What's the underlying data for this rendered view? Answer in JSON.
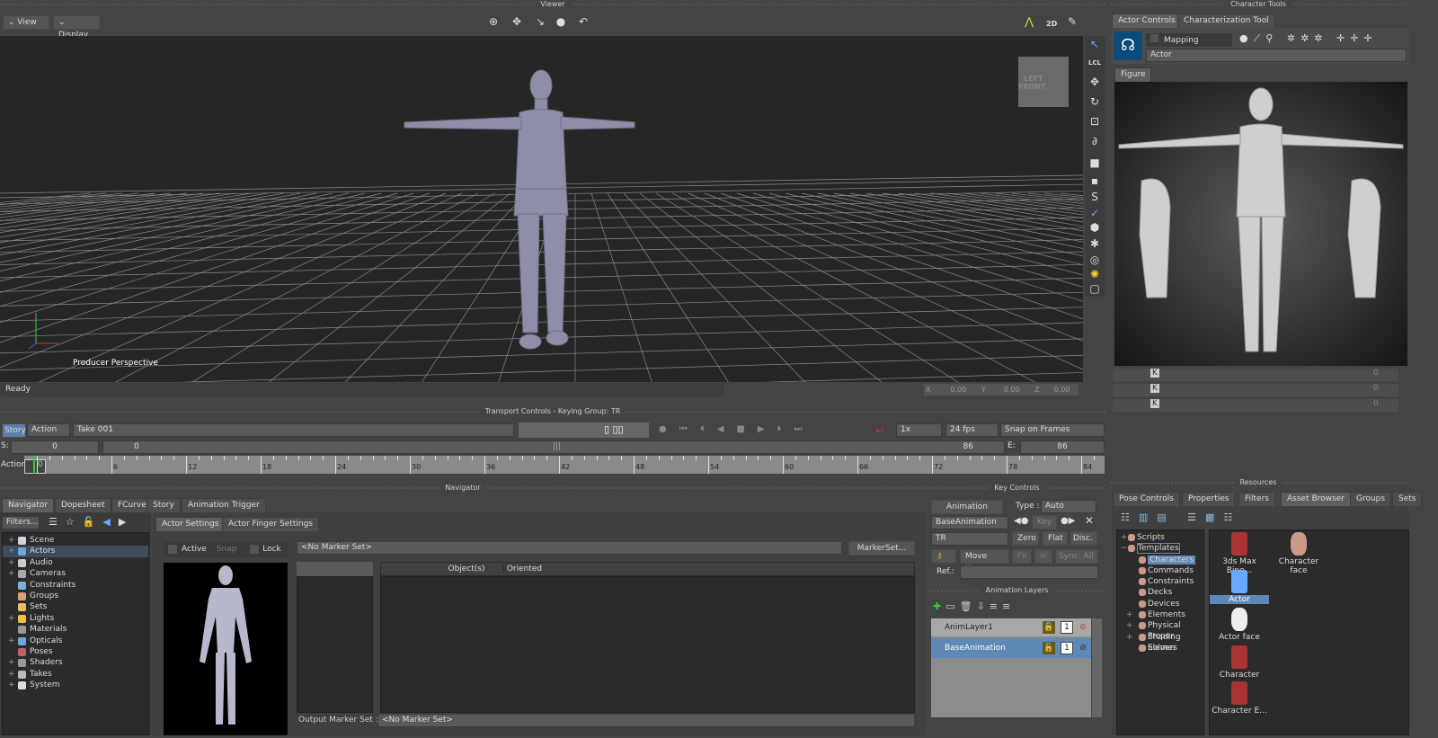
{
  "viewer": {
    "title": "Viewer",
    "view_label": "View",
    "display_label": "Display",
    "camera_label": "Producer Perspective",
    "cube_left": "LEFT",
    "cube_front": "FRONT",
    "status": "Ready",
    "x_label": "X",
    "x": "0.00",
    "y_label": "Y",
    "y": "0.00",
    "z_label": "Z",
    "z": "0.00",
    "mode_2d": "2D",
    "lcl": "LCL"
  },
  "character_tools": {
    "title": "Character Tools",
    "tabs": [
      "Actor Controls",
      "Characterization Tool"
    ],
    "mapping_label": "Mapping",
    "actor_select": "Actor",
    "figure_tab": "Figure",
    "rows": [
      {
        "k": "K",
        "value": "0"
      },
      {
        "k": "K",
        "value": "0"
      },
      {
        "k": "K",
        "value": "0"
      }
    ]
  },
  "transport": {
    "title": "Transport Controls  -  Keying Group: TR",
    "story": "Story",
    "action": "Action",
    "take": "Take 001",
    "speed": "1x",
    "fps": "24 fps",
    "snap": "Snap on Frames",
    "s_label": "S:",
    "start": "0",
    "slider_start": "0",
    "slider_end": "86",
    "e_label": "E:",
    "end": "86",
    "timeline_label": "Action",
    "current_frame": "0",
    "ticks": [
      "6",
      "12",
      "18",
      "24",
      "30",
      "36",
      "42",
      "48",
      "54",
      "60",
      "66",
      "72",
      "78",
      "84"
    ]
  },
  "navigator": {
    "title": "Navigator",
    "tabs": [
      "Navigator",
      "Dopesheet",
      "FCurves",
      "Story",
      "Animation Trigger"
    ],
    "filters": "Filters...",
    "tree": [
      {
        "label": "Scene",
        "plus": true,
        "color": "#cfd6e0"
      },
      {
        "label": "Actors",
        "plus": true,
        "color": "#6aa8e0",
        "selected": true
      },
      {
        "label": "Audio",
        "plus": true,
        "color": "#ccc"
      },
      {
        "label": "Cameras",
        "plus": true,
        "color": "#aaa"
      },
      {
        "label": "Constraints",
        "plus": false,
        "color": "#7ab0e0"
      },
      {
        "label": "Groups",
        "plus": false,
        "color": "#d9a070"
      },
      {
        "label": "Sets",
        "plus": false,
        "color": "#e0c060"
      },
      {
        "label": "Lights",
        "plus": true,
        "color": "#f0c040"
      },
      {
        "label": "Materials",
        "plus": false,
        "color": "#999"
      },
      {
        "label": "Opticals",
        "plus": true,
        "color": "#6aa8e0"
      },
      {
        "label": "Poses",
        "plus": false,
        "color": "#c06060"
      },
      {
        "label": "Shaders",
        "plus": true,
        "color": "#999"
      },
      {
        "label": "Takes",
        "plus": true,
        "color": "#bbb"
      },
      {
        "label": "System",
        "plus": true,
        "color": "#ddd"
      }
    ],
    "settings_tabs": [
      "Actor Settings",
      "Actor Finger Settings"
    ],
    "active": "Active",
    "snap": "Snap",
    "lock": "Lock",
    "marker_set": "<No Marker Set>",
    "marker_set_btn": "MarkerSet...",
    "col_objects": "Object(s)",
    "col_oriented": "Oriented",
    "output_label": "Output Marker Set :",
    "output_value": "<No Marker Set>"
  },
  "key_controls": {
    "title": "Key Controls",
    "animation": "Animation",
    "type_label": "Type :",
    "type": "Auto",
    "layer": "BaseAnimation",
    "key": "Key",
    "group": "TR",
    "zero": "Zero",
    "flat": "Flat",
    "disc": "Disc.",
    "move_keys": "Move Keys",
    "fk": "FK",
    "ik": "IK",
    "sync": "Sync. All",
    "ref": "Ref.:",
    "layers_title": "Animation Layers",
    "layers": [
      {
        "name": "AnimLayer1",
        "lock": "1"
      },
      {
        "name": "BaseAnimation",
        "lock": "1"
      }
    ]
  },
  "resources": {
    "title": "Resources",
    "tabs": [
      "Pose Controls",
      "Properties",
      "Filters",
      "Asset Browser",
      "Groups",
      "Sets"
    ],
    "tree": [
      {
        "label": "Scripts",
        "plus": "+"
      },
      {
        "label": "Templates",
        "plus": "−"
      },
      {
        "label": "Characters",
        "plus": ""
      },
      {
        "label": "Commands",
        "plus": ""
      },
      {
        "label": "Constraints",
        "plus": ""
      },
      {
        "label": "Decks",
        "plus": ""
      },
      {
        "label": "Devices",
        "plus": ""
      },
      {
        "label": "Elements",
        "plus": "+"
      },
      {
        "label": "Physical Proper",
        "plus": "+"
      },
      {
        "label": "Shading Elemer",
        "plus": "+"
      },
      {
        "label": "Solvers",
        "plus": ""
      }
    ],
    "assets": [
      "3ds Max Bipe...",
      "Character face",
      "Actor",
      "Actor face",
      "Character",
      "Character E..."
    ]
  }
}
